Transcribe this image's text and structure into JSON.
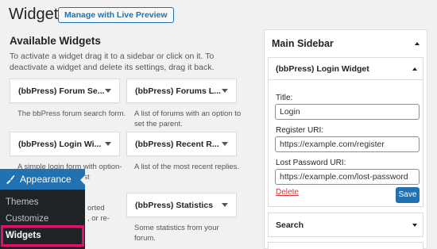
{
  "header": {
    "title": "Widgets",
    "preview_button": "Manage with Live Preview"
  },
  "available": {
    "title": "Available Widgets",
    "description": "To activate a widget drag it to a sidebar or click on it. To deactivate a widget and delete its settings, drag it back."
  },
  "widgets": [
    {
      "name": "(bbPress) Forum Se...",
      "description": "The bbPress forum search form."
    },
    {
      "name": "(bbPress) Forums L...",
      "description": "A list of forums with an option to set the parent."
    },
    {
      "name": "(bbPress) Login Wi...",
      "description": "A simple login form with option-"
    },
    {
      "name": "(bbPress) Recent R...",
      "description": "A list of the most recent replies."
    },
    {
      "name": "(bbPress) Statistics",
      "description": "Some statistics from your forum."
    }
  ],
  "partial_texts": {
    "desc_fragment_1": "ost",
    "desc_fragment_2": "orted",
    "desc_fragment_3": ", or re-"
  },
  "admin_menu": {
    "section": "Appearance",
    "items": [
      "Themes",
      "Customize",
      "Widgets"
    ],
    "active_item": "Widgets",
    "highlight_color": "#e0126b",
    "accent_color": "#2271b1"
  },
  "sidebar": {
    "title": "Main Sidebar",
    "login_widget": {
      "title": "(bbPress) Login Widget",
      "fields": [
        {
          "label": "Title:",
          "value": "Login"
        },
        {
          "label": "Register URI:",
          "value": "https://example.com/register"
        },
        {
          "label": "Lost Password URI:",
          "value": "https://example.com/lost-password"
        }
      ],
      "delete_label": "Delete",
      "save_label": "Save"
    },
    "search_widget": {
      "title": "Search"
    }
  }
}
